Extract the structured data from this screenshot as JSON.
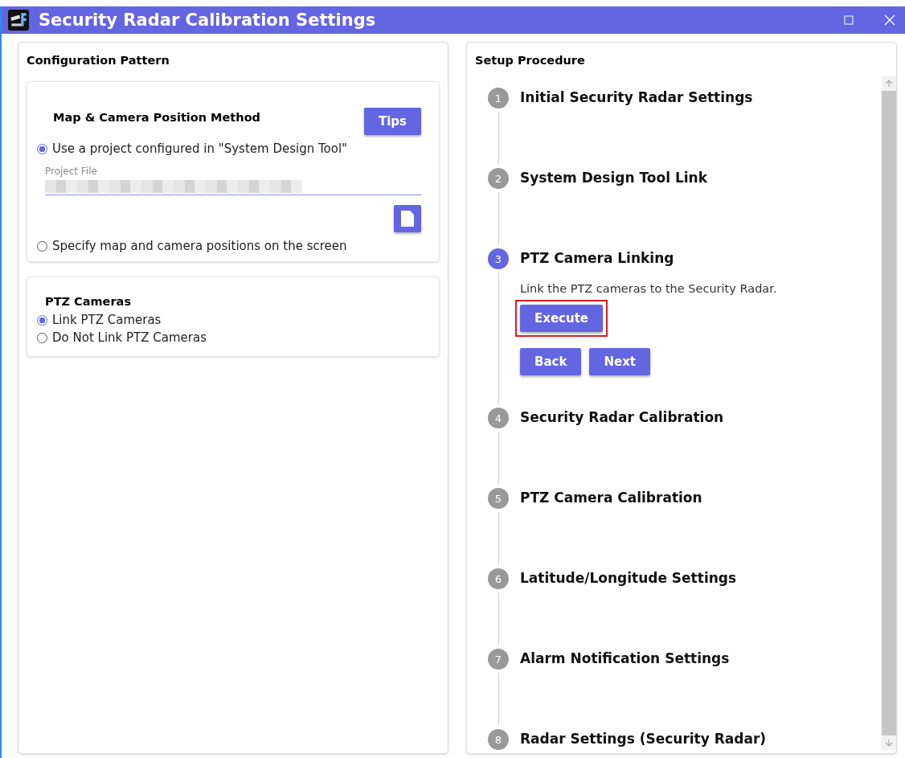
{
  "window": {
    "title": "Security Radar Calibration Settings"
  },
  "configuration": {
    "title": "Configuration Pattern",
    "map_method": {
      "title": "Map & Camera Position Method",
      "tips_button": "Tips",
      "options": [
        {
          "label": "Use a project configured in \"System Design Tool\"",
          "selected": true
        },
        {
          "label": "Specify map and camera positions on the screen",
          "selected": false
        }
      ],
      "project_file": {
        "label": "Project File"
      }
    },
    "ptz": {
      "title": "PTZ Cameras",
      "options": [
        {
          "label": "Link PTZ Cameras",
          "selected": true
        },
        {
          "label": "Do Not Link PTZ Cameras",
          "selected": false
        }
      ]
    }
  },
  "procedure": {
    "title": "Setup Procedure",
    "steps": [
      {
        "number": "1",
        "title": "Initial Security Radar Settings",
        "selected": false
      },
      {
        "number": "2",
        "title": "System Design Tool Link",
        "selected": false
      },
      {
        "number": "3",
        "title": "PTZ Camera Linking",
        "selected": true,
        "description": "Link the PTZ cameras to the Security Radar.",
        "execute_button": {
          "label": "Execute",
          "highlighted": true
        },
        "buttons": [
          "Back",
          "Next"
        ]
      },
      {
        "number": "4",
        "title": "Security Radar Calibration",
        "selected": false
      },
      {
        "number": "5",
        "title": "PTZ Camera Calibration",
        "selected": false
      },
      {
        "number": "6",
        "title": "Latitude/Longitude Settings",
        "selected": false
      },
      {
        "number": "7",
        "title": "Alarm Notification Settings",
        "selected": false
      },
      {
        "number": "8",
        "title": "Radar Settings (Security Radar)",
        "selected": false
      }
    ]
  }
}
